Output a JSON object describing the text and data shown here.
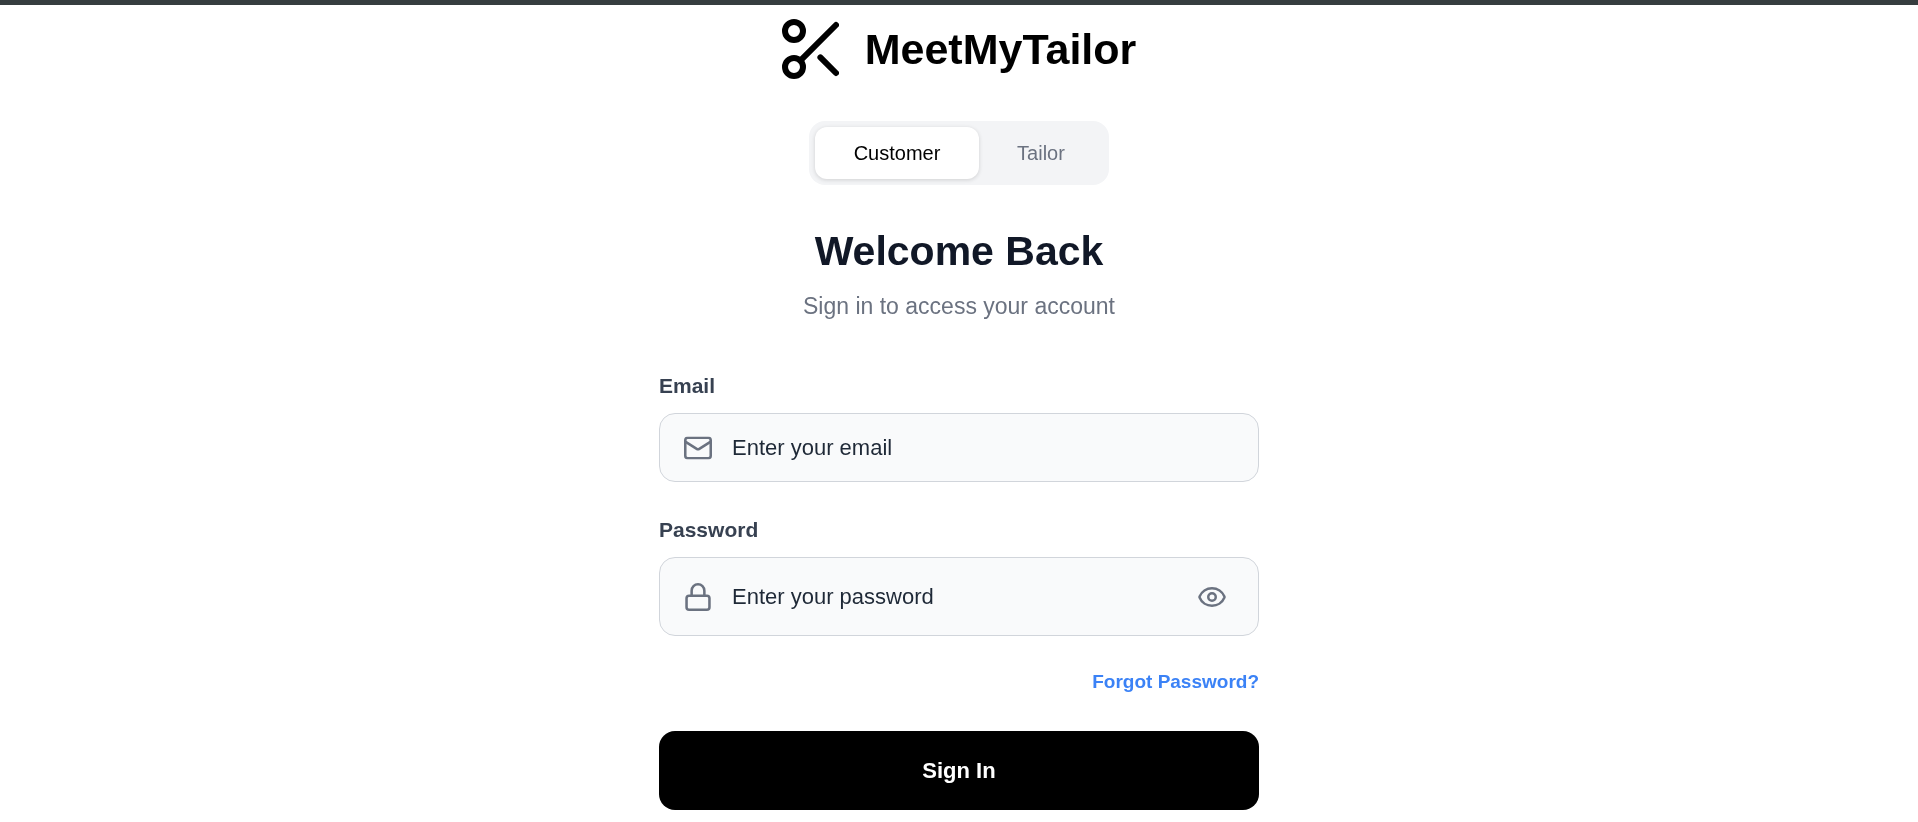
{
  "header": {
    "brand": "MeetMyTailor"
  },
  "role_tabs": [
    {
      "label": "Customer",
      "selected": true
    },
    {
      "label": "Tailor",
      "selected": false
    }
  ],
  "heading": {
    "title": "Welcome Back",
    "subtitle": "Sign in to access your account"
  },
  "form": {
    "fields": [
      {
        "kind": "email",
        "label": "Email",
        "placeholder": "Enter your email"
      },
      {
        "kind": "password",
        "label": "Password",
        "placeholder": "Enter your password"
      }
    ],
    "forgot_link": "Forgot Password?",
    "submit": "Sign In"
  }
}
